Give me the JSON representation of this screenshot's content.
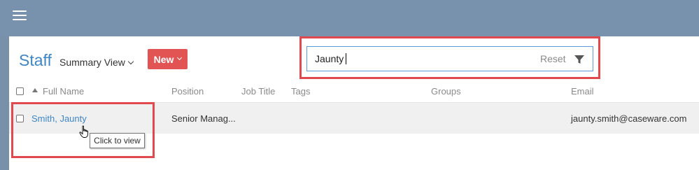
{
  "page": {
    "title": "Staff",
    "view_select": "Summary View",
    "new_button": "New"
  },
  "search": {
    "value": "Jaunty",
    "reset_label": "Reset"
  },
  "table": {
    "columns": [
      "Full Name",
      "Position",
      "Job Title",
      "Tags",
      "Groups",
      "Email"
    ],
    "rows": [
      {
        "full_name": "Smith, Jaunty",
        "position": "Senior Manag...",
        "job_title": "",
        "tags": "",
        "groups": "",
        "email": "jaunty.smith@caseware.com"
      }
    ]
  },
  "tooltip": "Click to view",
  "icons": {
    "menu": "hamburger-menu-icon",
    "view_dropdown": "chevron-down-icon",
    "new_dropdown": "chevron-down-icon",
    "filter": "filter-funnel-icon",
    "sort": "sort-ascending-icon",
    "cursor": "hand-pointer-icon"
  },
  "colors": {
    "topbar": "#7892ad",
    "accent_blue": "#3f86c6",
    "new_button": "#e25454",
    "highlight_border": "#e04a4f",
    "selected_row": "#f0f0f0"
  }
}
